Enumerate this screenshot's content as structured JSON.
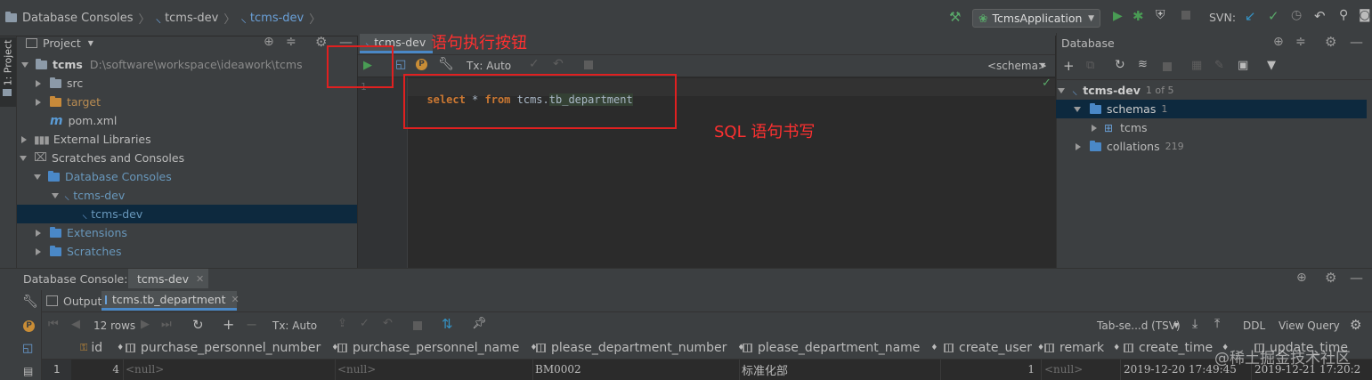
{
  "breadcrumb": {
    "items": [
      "Database Consoles",
      "tcms-dev",
      "tcms-dev"
    ]
  },
  "run_config": {
    "label": "TcmsApplication"
  },
  "svn_label": "SVN:",
  "left_rail": {
    "label": "1: Project"
  },
  "project_panel": {
    "title": "Project",
    "root": {
      "name": "tcms",
      "path": "D:\\software\\workspace\\ideawork\\tcms"
    },
    "items": [
      "src",
      "target",
      "pom.xml",
      "External Libraries",
      "Scratches and Consoles",
      "Database Consoles",
      "tcms-dev",
      "tcms-dev",
      "Extensions",
      "Scratches"
    ]
  },
  "editor": {
    "tab_label": "tcms-dev",
    "tx_label": "Tx: Auto",
    "schema_label": "<schema>",
    "line_number": "1",
    "sql": {
      "kw1": "select",
      "star": " * ",
      "kw2": "from",
      "rest1": " tcms.",
      "rest2": "tb_department"
    }
  },
  "annotations": {
    "run_button": "语句执行按钮",
    "sql_write": "SQL 语句书写"
  },
  "database_panel": {
    "title": "Database",
    "datasource": {
      "name": "tcms-dev",
      "count": "1 of 5"
    },
    "schemas": {
      "name": "schemas",
      "count": "1"
    },
    "schema_item": "tcms",
    "collations": {
      "name": "collations",
      "count": "219"
    }
  },
  "bottom_panel": {
    "title": "Database Console:",
    "tab_label": "tcms-dev",
    "output_tab": "Output",
    "result_tab": "tcms.tb_department",
    "rows_label": "12 rows",
    "tx_label": "Tx: Auto",
    "export_label": "Tab-se...d (TSV)",
    "ddl_label": "DDL",
    "view_query_label": "View Query"
  },
  "results": {
    "columns": [
      "id",
      "purchase_personnel_number",
      "purchase_personnel_name",
      "please_department_number",
      "please_department_name",
      "create_user",
      "remark",
      "create_time",
      "update_time"
    ],
    "row": {
      "row_number": "1",
      "id": "4",
      "purchase_personnel_number": "<null>",
      "purchase_personnel_name": "<null>",
      "please_department_number": "BM0002",
      "please_department_name": "标准化部",
      "create_user": "1",
      "remark": "<null>",
      "create_time": "2019-12-20 17:49:45",
      "update_time": "2019-12-21 17:20:2"
    }
  },
  "watermark": "@稀土掘金技术社区",
  "colors": {
    "run_green": "#499c54",
    "annotation_red": "#e02020",
    "selection": "#0d293e",
    "keyword": "#cc7832"
  }
}
